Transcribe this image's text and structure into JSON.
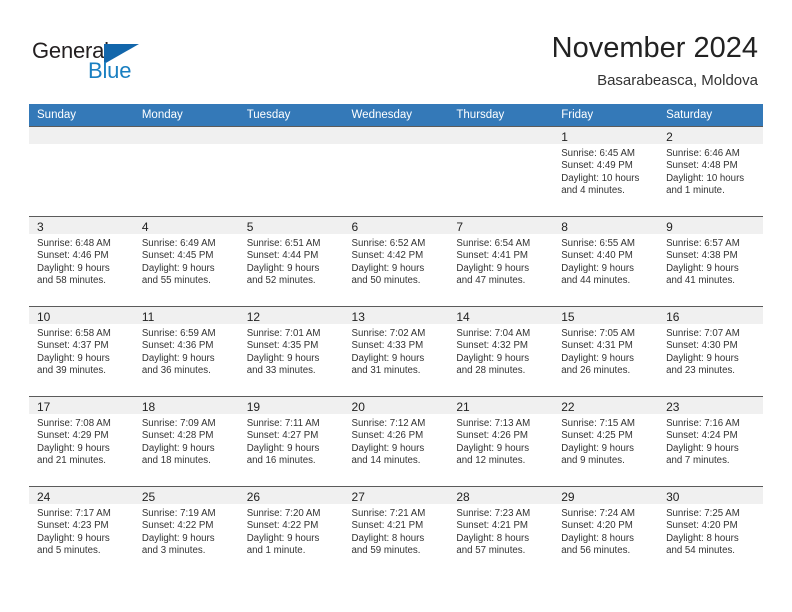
{
  "brand": {
    "name_part1": "General",
    "name_part2": "Blue"
  },
  "header": {
    "title": "November 2024",
    "subtitle": "Basarabeasca, Moldova"
  },
  "weekday_headers": [
    "Sunday",
    "Monday",
    "Tuesday",
    "Wednesday",
    "Thursday",
    "Friday",
    "Saturday"
  ],
  "colors": {
    "header_band": "#3479b8",
    "daynum_band": "#f0f0f0",
    "brand_blue": "#1a7fc1",
    "cell_border": "#5b5b5b"
  },
  "weeks": [
    [
      {
        "day": "",
        "empty": true
      },
      {
        "day": "",
        "empty": true
      },
      {
        "day": "",
        "empty": true
      },
      {
        "day": "",
        "empty": true
      },
      {
        "day": "",
        "empty": true
      },
      {
        "day": "1",
        "sunrise": "Sunrise: 6:45 AM",
        "sunset": "Sunset: 4:49 PM",
        "daylight": "Daylight: 10 hours and 4 minutes."
      },
      {
        "day": "2",
        "sunrise": "Sunrise: 6:46 AM",
        "sunset": "Sunset: 4:48 PM",
        "daylight": "Daylight: 10 hours and 1 minute."
      }
    ],
    [
      {
        "day": "3",
        "sunrise": "Sunrise: 6:48 AM",
        "sunset": "Sunset: 4:46 PM",
        "daylight": "Daylight: 9 hours and 58 minutes."
      },
      {
        "day": "4",
        "sunrise": "Sunrise: 6:49 AM",
        "sunset": "Sunset: 4:45 PM",
        "daylight": "Daylight: 9 hours and 55 minutes."
      },
      {
        "day": "5",
        "sunrise": "Sunrise: 6:51 AM",
        "sunset": "Sunset: 4:44 PM",
        "daylight": "Daylight: 9 hours and 52 minutes."
      },
      {
        "day": "6",
        "sunrise": "Sunrise: 6:52 AM",
        "sunset": "Sunset: 4:42 PM",
        "daylight": "Daylight: 9 hours and 50 minutes."
      },
      {
        "day": "7",
        "sunrise": "Sunrise: 6:54 AM",
        "sunset": "Sunset: 4:41 PM",
        "daylight": "Daylight: 9 hours and 47 minutes."
      },
      {
        "day": "8",
        "sunrise": "Sunrise: 6:55 AM",
        "sunset": "Sunset: 4:40 PM",
        "daylight": "Daylight: 9 hours and 44 minutes."
      },
      {
        "day": "9",
        "sunrise": "Sunrise: 6:57 AM",
        "sunset": "Sunset: 4:38 PM",
        "daylight": "Daylight: 9 hours and 41 minutes."
      }
    ],
    [
      {
        "day": "10",
        "sunrise": "Sunrise: 6:58 AM",
        "sunset": "Sunset: 4:37 PM",
        "daylight": "Daylight: 9 hours and 39 minutes."
      },
      {
        "day": "11",
        "sunrise": "Sunrise: 6:59 AM",
        "sunset": "Sunset: 4:36 PM",
        "daylight": "Daylight: 9 hours and 36 minutes."
      },
      {
        "day": "12",
        "sunrise": "Sunrise: 7:01 AM",
        "sunset": "Sunset: 4:35 PM",
        "daylight": "Daylight: 9 hours and 33 minutes."
      },
      {
        "day": "13",
        "sunrise": "Sunrise: 7:02 AM",
        "sunset": "Sunset: 4:33 PM",
        "daylight": "Daylight: 9 hours and 31 minutes."
      },
      {
        "day": "14",
        "sunrise": "Sunrise: 7:04 AM",
        "sunset": "Sunset: 4:32 PM",
        "daylight": "Daylight: 9 hours and 28 minutes."
      },
      {
        "day": "15",
        "sunrise": "Sunrise: 7:05 AM",
        "sunset": "Sunset: 4:31 PM",
        "daylight": "Daylight: 9 hours and 26 minutes."
      },
      {
        "day": "16",
        "sunrise": "Sunrise: 7:07 AM",
        "sunset": "Sunset: 4:30 PM",
        "daylight": "Daylight: 9 hours and 23 minutes."
      }
    ],
    [
      {
        "day": "17",
        "sunrise": "Sunrise: 7:08 AM",
        "sunset": "Sunset: 4:29 PM",
        "daylight": "Daylight: 9 hours and 21 minutes."
      },
      {
        "day": "18",
        "sunrise": "Sunrise: 7:09 AM",
        "sunset": "Sunset: 4:28 PM",
        "daylight": "Daylight: 9 hours and 18 minutes."
      },
      {
        "day": "19",
        "sunrise": "Sunrise: 7:11 AM",
        "sunset": "Sunset: 4:27 PM",
        "daylight": "Daylight: 9 hours and 16 minutes."
      },
      {
        "day": "20",
        "sunrise": "Sunrise: 7:12 AM",
        "sunset": "Sunset: 4:26 PM",
        "daylight": "Daylight: 9 hours and 14 minutes."
      },
      {
        "day": "21",
        "sunrise": "Sunrise: 7:13 AM",
        "sunset": "Sunset: 4:26 PM",
        "daylight": "Daylight: 9 hours and 12 minutes."
      },
      {
        "day": "22",
        "sunrise": "Sunrise: 7:15 AM",
        "sunset": "Sunset: 4:25 PM",
        "daylight": "Daylight: 9 hours and 9 minutes."
      },
      {
        "day": "23",
        "sunrise": "Sunrise: 7:16 AM",
        "sunset": "Sunset: 4:24 PM",
        "daylight": "Daylight: 9 hours and 7 minutes."
      }
    ],
    [
      {
        "day": "24",
        "sunrise": "Sunrise: 7:17 AM",
        "sunset": "Sunset: 4:23 PM",
        "daylight": "Daylight: 9 hours and 5 minutes."
      },
      {
        "day": "25",
        "sunrise": "Sunrise: 7:19 AM",
        "sunset": "Sunset: 4:22 PM",
        "daylight": "Daylight: 9 hours and 3 minutes."
      },
      {
        "day": "26",
        "sunrise": "Sunrise: 7:20 AM",
        "sunset": "Sunset: 4:22 PM",
        "daylight": "Daylight: 9 hours and 1 minute."
      },
      {
        "day": "27",
        "sunrise": "Sunrise: 7:21 AM",
        "sunset": "Sunset: 4:21 PM",
        "daylight": "Daylight: 8 hours and 59 minutes."
      },
      {
        "day": "28",
        "sunrise": "Sunrise: 7:23 AM",
        "sunset": "Sunset: 4:21 PM",
        "daylight": "Daylight: 8 hours and 57 minutes."
      },
      {
        "day": "29",
        "sunrise": "Sunrise: 7:24 AM",
        "sunset": "Sunset: 4:20 PM",
        "daylight": "Daylight: 8 hours and 56 minutes."
      },
      {
        "day": "30",
        "sunrise": "Sunrise: 7:25 AM",
        "sunset": "Sunset: 4:20 PM",
        "daylight": "Daylight: 8 hours and 54 minutes."
      }
    ]
  ]
}
